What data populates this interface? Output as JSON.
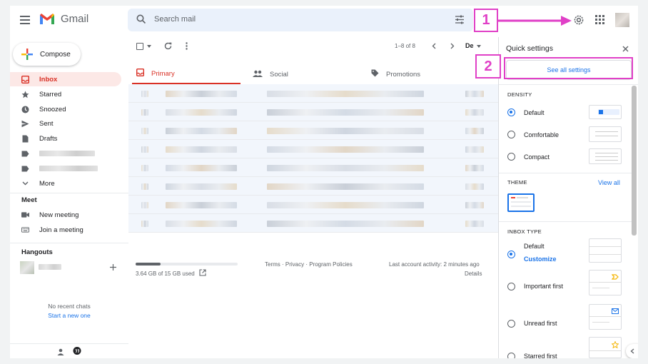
{
  "header": {
    "app_name": "Gmail",
    "search_placeholder": "Search mail"
  },
  "nav": {
    "compose": "Compose",
    "items": [
      {
        "label": "Inbox",
        "icon": "inbox-icon",
        "active": true
      },
      {
        "label": "Starred",
        "icon": "star-icon"
      },
      {
        "label": "Snoozed",
        "icon": "clock-icon"
      },
      {
        "label": "Sent",
        "icon": "send-icon"
      },
      {
        "label": "Drafts",
        "icon": "draft-icon"
      }
    ],
    "more": "More",
    "meet_heading": "Meet",
    "meet_new": "New meeting",
    "meet_join": "Join a meeting",
    "hangouts_heading": "Hangouts",
    "no_chats": "No recent chats",
    "start_new": "Start a new one"
  },
  "toolbar": {
    "range": "1–8 of 8",
    "sort_partial": "De"
  },
  "tabs": [
    {
      "label": "Primary",
      "icon": "inbox-icon",
      "active": true
    },
    {
      "label": "Social",
      "icon": "people-icon"
    },
    {
      "label": "Promotions",
      "icon": "tag-icon"
    }
  ],
  "footer": {
    "storage": "3.64 GB of 15 GB used",
    "storage_fraction": 0.243,
    "links": "Terms · Privacy · Program Policies",
    "activity": "Last account activity: 2 minutes ago",
    "details": "Details"
  },
  "quick_settings": {
    "title": "Quick settings",
    "see_all": "See all settings",
    "density_heading": "DENSITY",
    "density_options": [
      "Default",
      "Comfortable",
      "Compact"
    ],
    "density_selected": "Default",
    "theme_heading": "THEME",
    "view_all": "View all",
    "inbox_type_heading": "INBOX TYPE",
    "inbox_options": [
      "Default",
      "Important first",
      "Unread first",
      "Starred first"
    ],
    "inbox_selected": "Default",
    "customize": "Customize"
  },
  "annotations": {
    "step1": "1",
    "step2": "2",
    "color": "#e040c7"
  },
  "colors": {
    "accent": "#1a73e8",
    "active_red": "#d93025"
  }
}
